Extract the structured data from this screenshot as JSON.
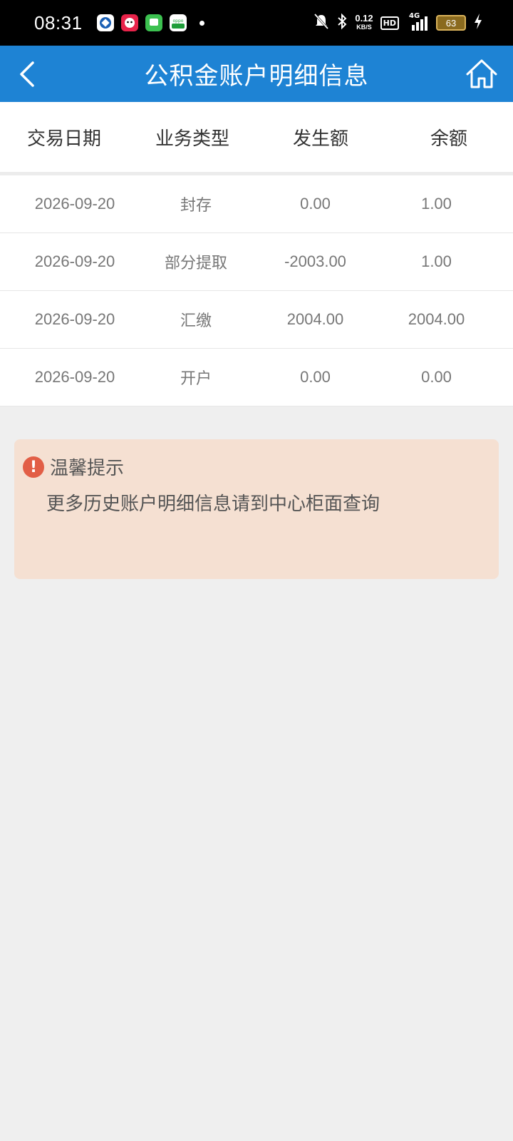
{
  "status_bar": {
    "time": "08:31",
    "net_speed_value": "0.12",
    "net_speed_unit": "KB/S",
    "hd": "HD",
    "signal": "4G",
    "battery": "63"
  },
  "nav": {
    "title": "公积金账户明细信息"
  },
  "table": {
    "headers": [
      "交易日期",
      "业务类型",
      "发生额",
      "余额"
    ],
    "rows": [
      {
        "date": "2026-09-20",
        "type": "封存",
        "amount": "0.00",
        "balance": "1.00"
      },
      {
        "date": "2026-09-20",
        "type": "部分提取",
        "amount": "-2003.00",
        "balance": "1.00"
      },
      {
        "date": "2026-09-20",
        "type": "汇缴",
        "amount": "2004.00",
        "balance": "2004.00"
      },
      {
        "date": "2026-09-20",
        "type": "开户",
        "amount": "0.00",
        "balance": "0.00"
      }
    ]
  },
  "notice": {
    "icon_glyph": "!",
    "title": "温馨提示",
    "text": "更多历史账户明细信息请到中心柜面查询"
  },
  "colors": {
    "nav_bg": "#1e83d4",
    "notice_bg": "#f5e0d2",
    "notice_icon": "#e25e46"
  }
}
